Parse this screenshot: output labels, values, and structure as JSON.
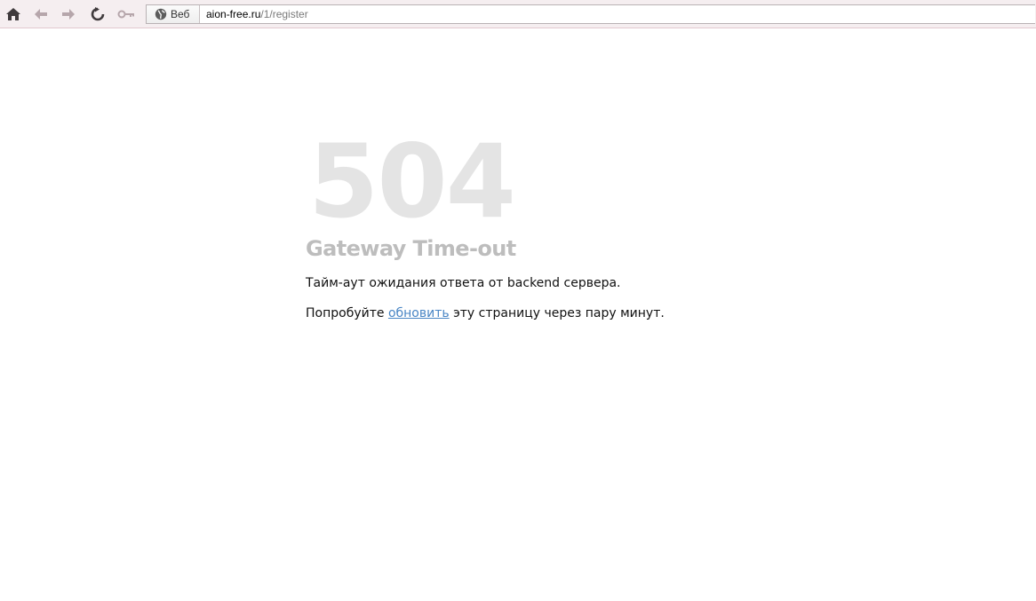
{
  "browser": {
    "toolbar": {
      "home_icon": "home-icon",
      "back_icon": "back-arrow-icon",
      "forward_icon": "forward-arrow-icon",
      "reload_icon": "reload-icon",
      "key_icon": "key-icon"
    },
    "address_bar": {
      "site_badge_label": "Веб",
      "url_host": "aion-free.ru",
      "url_path": "/1/register"
    }
  },
  "page": {
    "error_code": "504",
    "error_title": "Gateway Time-out",
    "message": "Тайм-аут ожидания ответа от backend сервера.",
    "retry_prefix": "Попробуйте ",
    "retry_link": "обновить",
    "retry_suffix": " эту страницу через пару минут."
  },
  "colors": {
    "toolbar_bg": "#f5eef0",
    "toolbar_icon": "#8f7f84",
    "error_code": "#e4e4e4",
    "error_title": "#bdbdbd",
    "link": "#4a86c5"
  }
}
